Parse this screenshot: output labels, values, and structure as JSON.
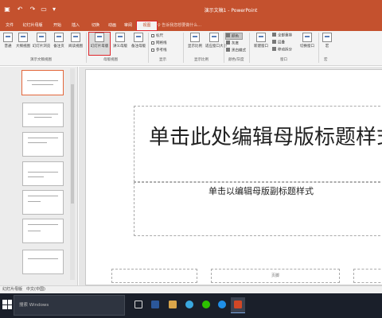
{
  "window": {
    "title": "演示文稿1 - PowerPoint",
    "quick_access": [
      "save-icon",
      "undo-icon",
      "redo-icon",
      "start-from-beginning-icon",
      "customize-icon"
    ]
  },
  "tabs": [
    {
      "label": "文件"
    },
    {
      "label": "幻灯片母版"
    },
    {
      "label": "开始"
    },
    {
      "label": "插入"
    },
    {
      "label": "切换"
    },
    {
      "label": "动画"
    },
    {
      "label": "审阅"
    },
    {
      "label": "视图",
      "active": true
    }
  ],
  "tell_me": "告诉我您想要做什么...",
  "ribbon": {
    "presentation_views": {
      "label": "演示文稿视图",
      "buttons": [
        "普通",
        "大纲视图",
        "幻灯片浏览",
        "备注页",
        "阅读视图"
      ]
    },
    "master_views": {
      "label": "母版视图",
      "buttons": [
        "幻灯片母版",
        "讲义母版",
        "备注母版"
      ]
    },
    "show": {
      "label": "显示",
      "checkboxes": [
        "标尺",
        "网格线",
        "参考线"
      ]
    },
    "zoom": {
      "label": "显示比例",
      "buttons": [
        "显示比例",
        "适应窗口大小"
      ]
    },
    "color": {
      "label": "颜色/灰度",
      "options": [
        "颜色",
        "灰度",
        "黑白模式"
      ]
    },
    "window_group": {
      "label": "窗口",
      "new_window": "新建窗口",
      "options": [
        "全部重排",
        "层叠",
        "移动拆分"
      ],
      "switch_windows": "切换窗口"
    },
    "macros": {
      "label": "宏",
      "button": "宏"
    }
  },
  "slide": {
    "title_placeholder": "单击此处编辑母版标题样式",
    "subtitle_placeholder": "单击以编辑母版副标题样式",
    "footer": "页脚"
  },
  "statusbar": {
    "view": "幻灯片母版",
    "language": "中文(中国)"
  },
  "taskbar": {
    "search_placeholder": "搜索 Windows",
    "apps": [
      "task-view-icon",
      "word-icon",
      "photos-icon",
      "qq-icon",
      "wechat-icon",
      "xunlei-icon",
      "powerpoint-icon"
    ]
  }
}
